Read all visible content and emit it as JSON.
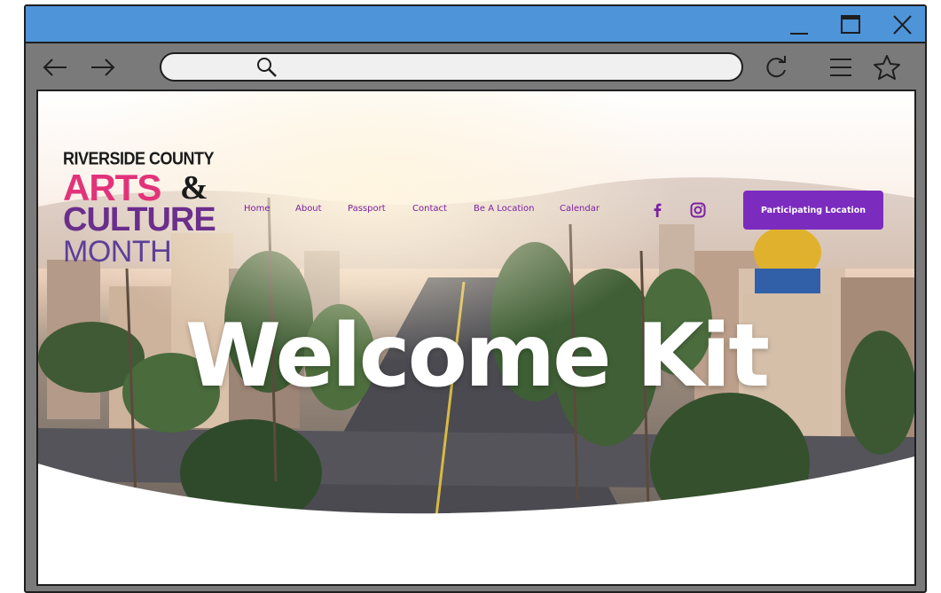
{
  "window": {
    "controls": {
      "minimize": "minimize-icon",
      "maximize": "maximize-icon",
      "close": "close-icon"
    }
  },
  "toolbar": {
    "back": "arrow-left-icon",
    "forward": "arrow-right-icon",
    "address": {
      "value": "",
      "placeholder": ""
    },
    "reload": "reload-icon",
    "menu": "hamburger-menu-icon",
    "bookmark": "star-icon"
  },
  "site": {
    "logo": {
      "line1": "RIVERSIDE COUNTY",
      "line2": "ARTS",
      "amp": "&",
      "line3": "CULTURE",
      "line4": "MONTH"
    },
    "nav": [
      "Home",
      "About",
      "Passport",
      "Contact",
      "Be A Location",
      "Calendar"
    ],
    "social": [
      "facebook-icon",
      "instagram-icon"
    ],
    "cta_label": "Participating Location",
    "hero_title": "Welcome Kit",
    "colors": {
      "accent": "#7b2cbf",
      "nav_text": "#7b1fa2",
      "logo_pink": "#e2337a",
      "logo_purple": "#6a2e8c",
      "titlebar": "#4d94d9",
      "chrome": "#7a7a7a"
    }
  }
}
